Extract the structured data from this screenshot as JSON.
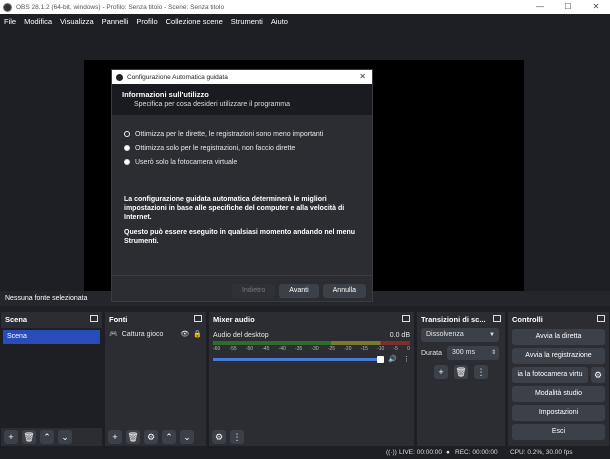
{
  "window": {
    "title": "OBS 28.1.2 (64-bit, windows) - Profilo: Senza titolo - Scene: Senza titolo",
    "minimize": "—",
    "maximize": "☐",
    "close": "✕"
  },
  "menu": [
    "File",
    "Modifica",
    "Visualizza",
    "Pannelli",
    "Profilo",
    "Collezione scene",
    "Strumenti",
    "Aiuto"
  ],
  "status_line": "Nessuna fonte selezionata",
  "dialog": {
    "title": "Configurazione Automatica guidata",
    "close": "✕",
    "heading": "Informazioni sull'utilizzo",
    "subheading": "Specifica per cosa desideri utilizzare il programma",
    "options": [
      {
        "label": "Ottimizza per le dirette, le registrazioni sono meno importanti",
        "selected": true
      },
      {
        "label": "Ottimizza solo per le registrazioni, non faccio dirette",
        "selected": false
      },
      {
        "label": "Userò solo la fotocamera virtuale",
        "selected": false
      }
    ],
    "desc1": "La configurazione guidata automatica determinerà le migliori impostazioni in base alle specifiche del computer e alla velocità di Internet.",
    "desc2": "Questo può essere eseguito in qualsiasi momento andando nel menu Strumenti.",
    "back": "Indietro",
    "next": "Avanti",
    "cancel": "Annulla"
  },
  "docks": {
    "scenes": {
      "title": "Scena",
      "items": [
        "Scena"
      ]
    },
    "sources": {
      "title": "Fonti",
      "items": [
        "Cattura gioco"
      ]
    },
    "mixer": {
      "title": "Mixer audio",
      "channel": "Audio del desktop",
      "level": "0.0 dB",
      "ticks": [
        "-60",
        "-55",
        "-50",
        "-45",
        "-40",
        "-35",
        "-30",
        "-25",
        "-20",
        "-15",
        "-10",
        "-5",
        "0"
      ],
      "volume_fraction": 1.0
    },
    "transitions": {
      "title": "Transizioni di sc...",
      "selected": "Dissolvenza",
      "duration_label": "Durata",
      "duration": "300 ms"
    },
    "controls": {
      "title": "Controlli",
      "buttons": [
        "Avvia la diretta",
        "Avvia la registrazione",
        "ia la fotocamera virtu",
        "Modalità studio",
        "Impostazioni",
        "Esci"
      ]
    }
  },
  "statusbar": {
    "live": "LIVE: 00:00:00",
    "rec": "REC: 00:00:00",
    "cpu": "CPU: 0.2%, 30.00 fps"
  }
}
